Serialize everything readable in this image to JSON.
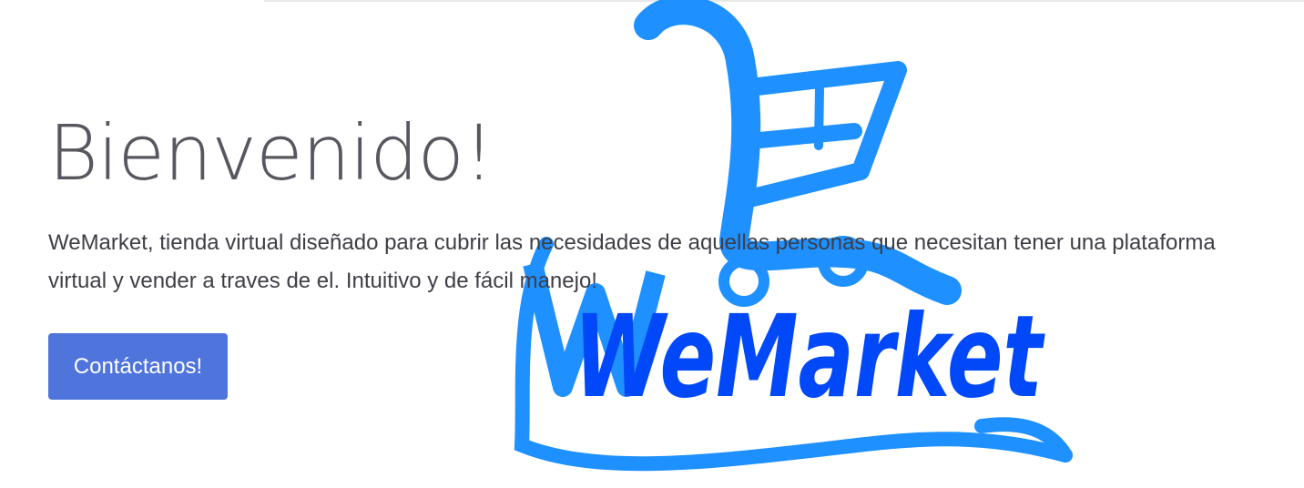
{
  "hero": {
    "title": "Bienvenido!",
    "description": "WeMarket, tienda virtual diseñado para cubrir las necesidades de aquellas personas que necesitan tener una plataforma virtual y vender a traves de el. Intuitivo y de fácil manejo!",
    "button_label": "Contáctanos!"
  },
  "logo": {
    "text": "WeMarket",
    "icon": "shopping-cart-icon",
    "color": "#1e90ff",
    "text_color": "#0048f8"
  },
  "colors": {
    "button": "#4f74dc",
    "title": "#575760",
    "body_text": "#3e3e46"
  }
}
